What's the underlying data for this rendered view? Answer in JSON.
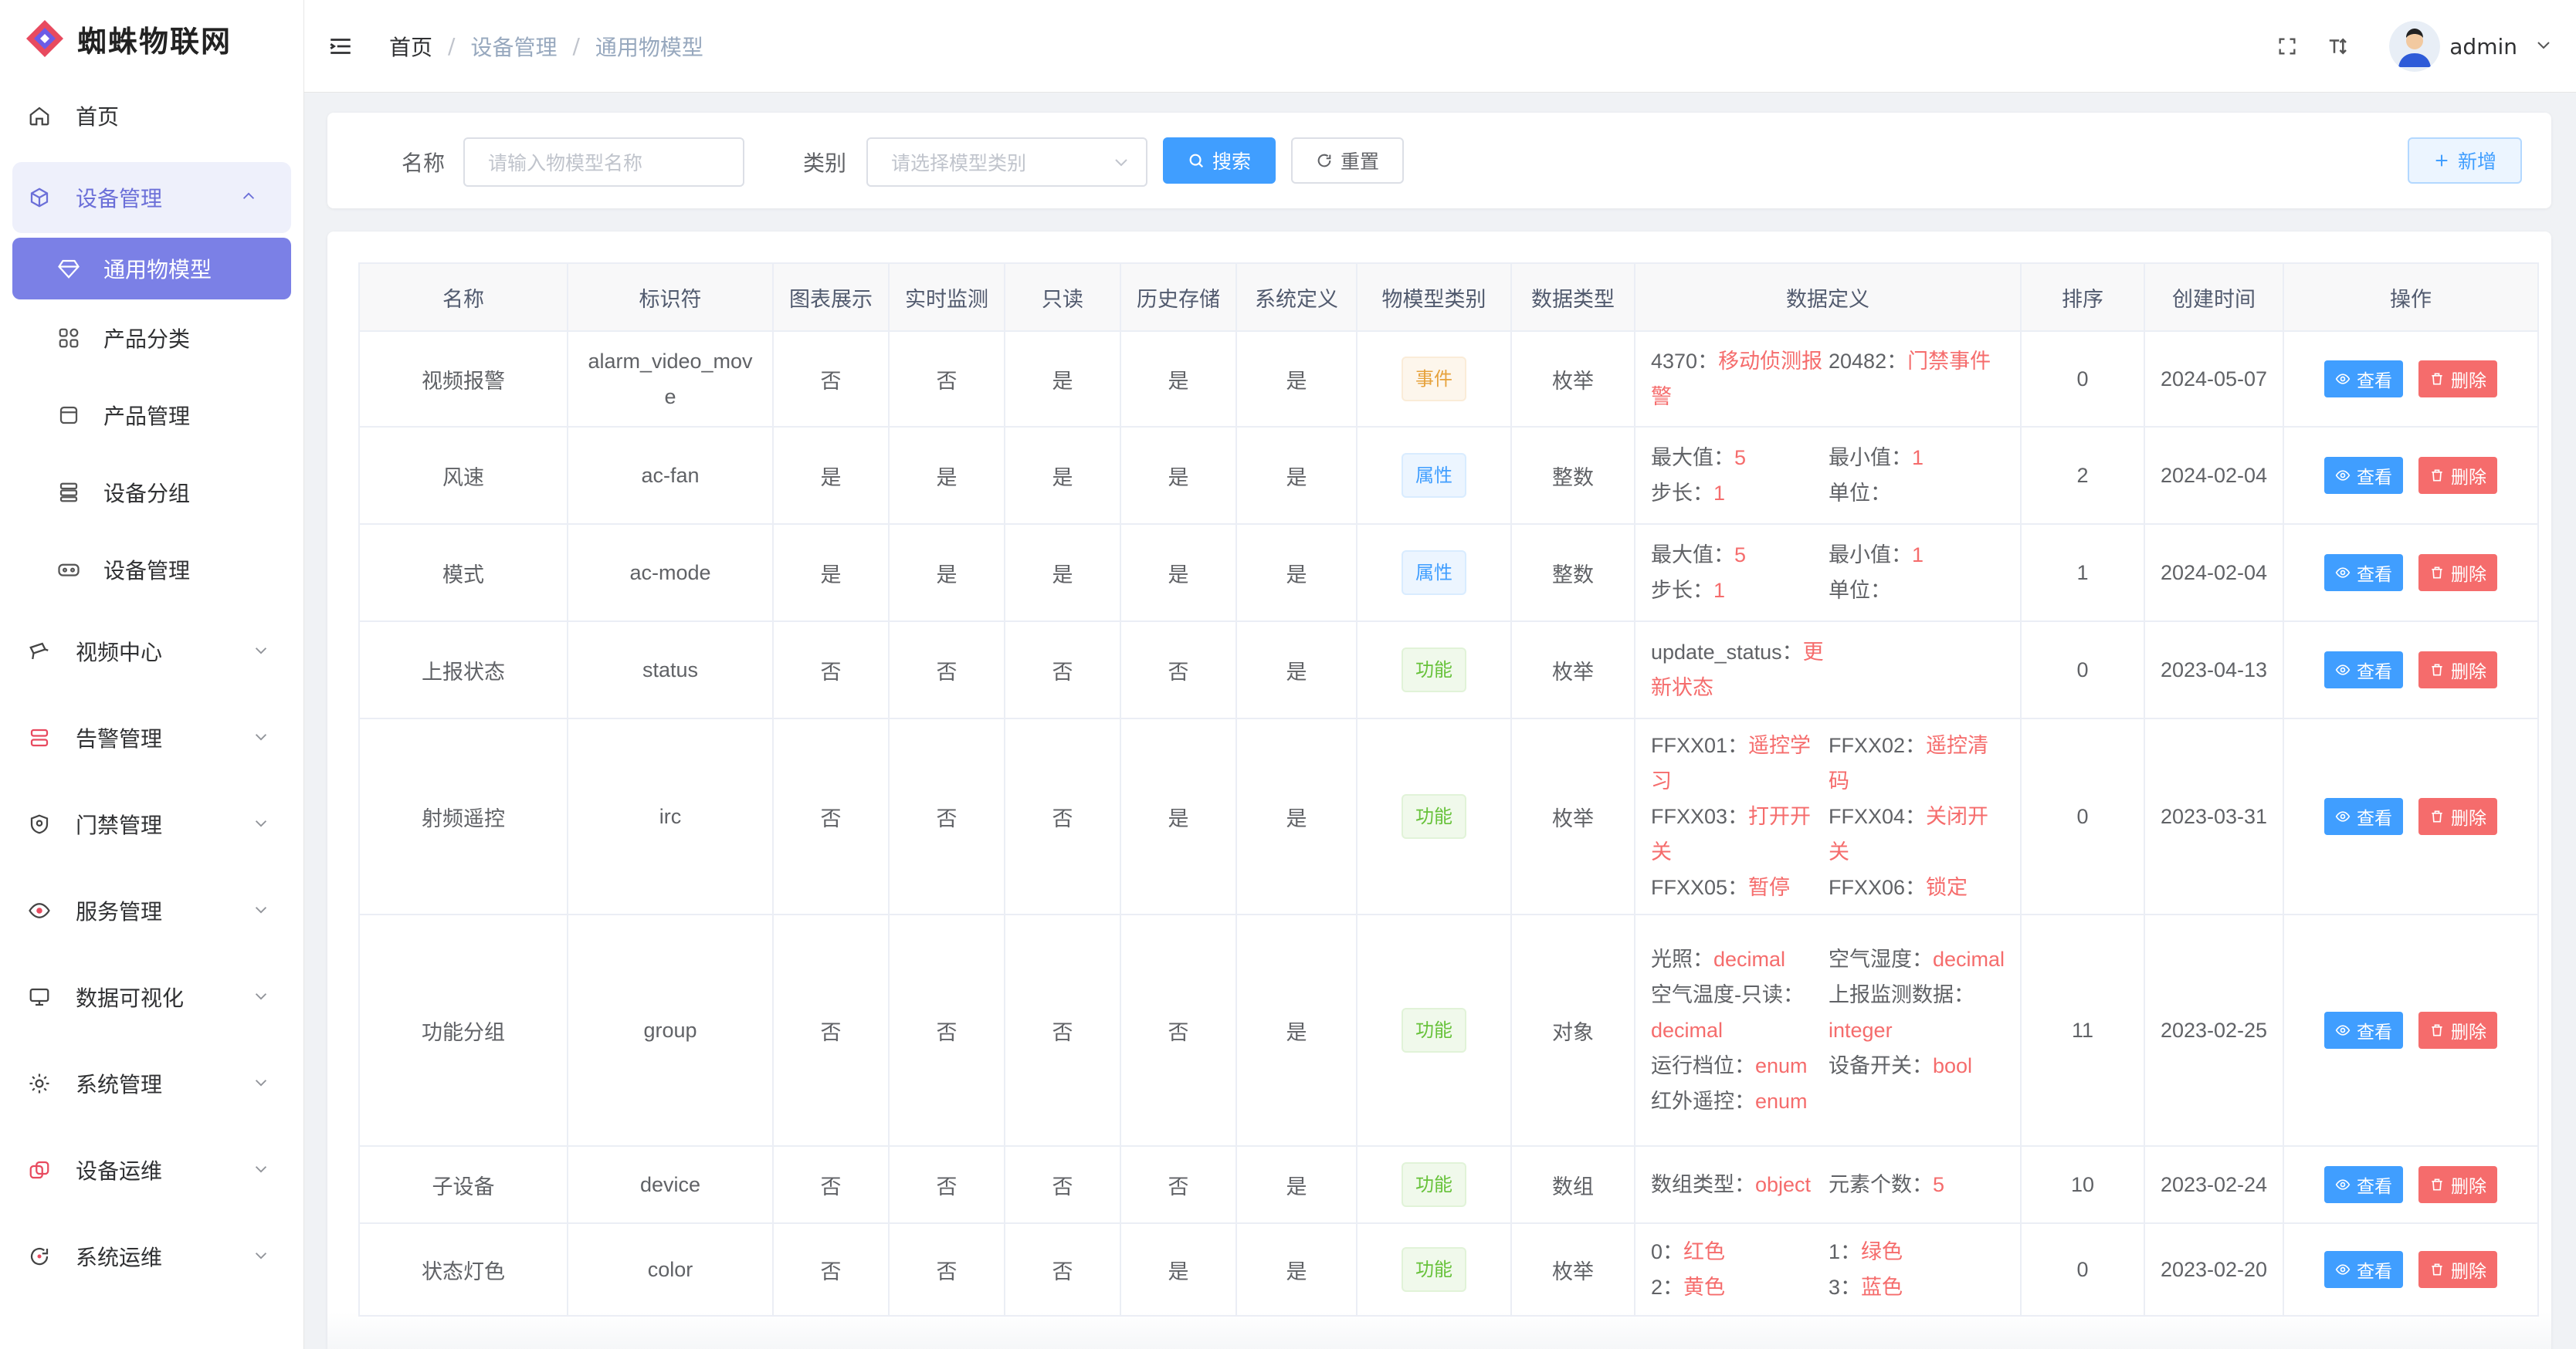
{
  "app": {
    "title": "蜘蛛物联网"
  },
  "sidebar": {
    "home": "首页",
    "device_mgmt": {
      "label": "设备管理",
      "children": [
        "通用物模型",
        "产品分类",
        "产品管理",
        "设备分组",
        "设备管理"
      ]
    },
    "items": [
      "视频中心",
      "告警管理",
      "门禁管理",
      "服务管理",
      "数据可视化",
      "系统管理",
      "设备运维",
      "系统运维"
    ]
  },
  "header": {
    "breadcrumb": [
      "首页",
      "设备管理",
      "通用物模型"
    ],
    "sep": "/",
    "user": "admin"
  },
  "search": {
    "name_label": "名称",
    "name_placeholder": "请输入物模型名称",
    "type_label": "类别",
    "type_placeholder": "请选择模型类别",
    "search_btn": "搜索",
    "reset_btn": "重置",
    "add_btn": "新增"
  },
  "table": {
    "columns": [
      "名称",
      "标识符",
      "图表展示",
      "实时监测",
      "只读",
      "历史存储",
      "系统定义",
      "物模型类别",
      "数据类型",
      "数据定义",
      "排序",
      "创建时间",
      "操作"
    ],
    "view_label": "查看",
    "delete_label": "删除",
    "rows": [
      {
        "name": "视频报警",
        "id": "alarm_video_mov\ne",
        "chart": "否",
        "monitor": "否",
        "readonly": "是",
        "history": "是",
        "system": "是",
        "category": "事件",
        "cat_type": "event",
        "dtype": "枚举",
        "defs": [
          [
            "4370：",
            "移动侦测报警"
          ],
          [
            "20482：",
            "门禁事件"
          ]
        ],
        "sort": "0",
        "created": "2024-05-07"
      },
      {
        "name": "风速",
        "id": "ac-fan",
        "chart": "是",
        "monitor": "是",
        "readonly": "是",
        "history": "是",
        "system": "是",
        "category": "属性",
        "cat_type": "prop",
        "dtype": "整数",
        "defs": [
          [
            "最大值：",
            "5"
          ],
          [
            "最小值：",
            "1"
          ],
          [
            "步长：",
            "1"
          ],
          [
            "单位：",
            ""
          ]
        ],
        "sort": "2",
        "created": "2024-02-04"
      },
      {
        "name": "模式",
        "id": "ac-mode",
        "chart": "是",
        "monitor": "是",
        "readonly": "是",
        "history": "是",
        "system": "是",
        "category": "属性",
        "cat_type": "prop",
        "dtype": "整数",
        "defs": [
          [
            "最大值：",
            "5"
          ],
          [
            "最小值：",
            "1"
          ],
          [
            "步长：",
            "1"
          ],
          [
            "单位：",
            ""
          ]
        ],
        "sort": "1",
        "created": "2024-02-04"
      },
      {
        "name": "上报状态",
        "id": "status",
        "chart": "否",
        "monitor": "否",
        "readonly": "否",
        "history": "否",
        "system": "是",
        "category": "功能",
        "cat_type": "func",
        "dtype": "枚举",
        "defs": [
          [
            "update_status：",
            "更新状态"
          ]
        ],
        "sort": "0",
        "created": "2023-04-13"
      },
      {
        "name": "射频遥控",
        "id": "irc",
        "chart": "否",
        "monitor": "否",
        "readonly": "否",
        "history": "是",
        "system": "是",
        "category": "功能",
        "cat_type": "func",
        "dtype": "枚举",
        "defs": [
          [
            "FFXX01：",
            "遥控学习"
          ],
          [
            "FFXX02：",
            "遥控清码"
          ],
          [
            "FFXX03：",
            "打开开关"
          ],
          [
            "FFXX04：",
            "关闭开关"
          ],
          [
            "FFXX05：",
            "暂停"
          ],
          [
            "FFXX06：",
            "锁定"
          ]
        ],
        "sort": "0",
        "created": "2023-03-31"
      },
      {
        "name": "功能分组",
        "id": "group",
        "chart": "否",
        "monitor": "否",
        "readonly": "否",
        "history": "否",
        "system": "是",
        "category": "功能",
        "cat_type": "func",
        "dtype": "对象",
        "defs": [
          [
            "光照：",
            "decimal"
          ],
          [
            "空气湿度：",
            "decimal"
          ],
          [
            "空气温度-只读：",
            "decimal"
          ],
          [
            "上报监测数据：",
            "integer"
          ],
          [
            "运行档位：",
            "enum"
          ],
          [
            "设备开关：",
            "bool"
          ],
          [
            "红外遥控：",
            "enum"
          ]
        ],
        "sort": "11",
        "created": "2023-02-25"
      },
      {
        "name": "子设备",
        "id": "device",
        "chart": "否",
        "monitor": "否",
        "readonly": "否",
        "history": "否",
        "system": "是",
        "category": "功能",
        "cat_type": "func",
        "dtype": "数组",
        "defs": [
          [
            "数组类型：",
            "object"
          ],
          [
            "元素个数：",
            "5"
          ]
        ],
        "sort": "10",
        "created": "2023-02-24"
      },
      {
        "name": "状态灯色",
        "id": "color",
        "chart": "否",
        "monitor": "否",
        "readonly": "否",
        "history": "是",
        "system": "是",
        "category": "功能",
        "cat_type": "func",
        "dtype": "枚举",
        "defs": [
          [
            "0：",
            "红色"
          ],
          [
            "1：",
            "绿色"
          ],
          [
            "2：",
            "黄色"
          ],
          [
            "3：",
            "蓝色"
          ]
        ],
        "sort": "0",
        "created": "2023-02-20"
      }
    ]
  },
  "colors": {
    "primary": "#409eff",
    "danger": "#f56c6c",
    "accent": "#7b80e6"
  }
}
